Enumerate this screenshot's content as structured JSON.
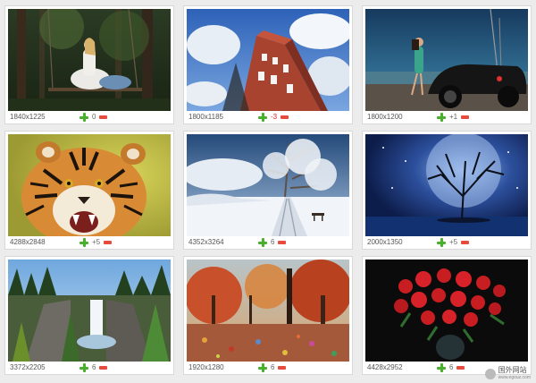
{
  "cards": [
    {
      "dims": "1840x1225",
      "score": "0",
      "scene": "forest-swing-photo"
    },
    {
      "dims": "1800x1185",
      "score": "-3",
      "scene": "tower-sky-photo"
    },
    {
      "dims": "1800x1200",
      "score": "+1",
      "scene": "woman-car-photo"
    },
    {
      "dims": "4288x2848",
      "score": "+5",
      "scene": "tiger-photo"
    },
    {
      "dims": "4352x3264",
      "score": "6",
      "scene": "snow-road-photo"
    },
    {
      "dims": "2000x1350",
      "score": "+5",
      "scene": "moon-tree-photo"
    },
    {
      "dims": "3372x2205",
      "score": "6",
      "scene": "waterfall-photo"
    },
    {
      "dims": "1920x1280",
      "score": "6",
      "scene": "autumn-park-photo"
    },
    {
      "dims": "4428x2952",
      "score": "6",
      "scene": "red-roses-photo"
    }
  ],
  "watermark": {
    "title": "国外网站",
    "url": "www.egouz.com"
  },
  "colors": {
    "plus": "#49b02b",
    "minus": "#e64b3c",
    "negative_score": "#dd2222"
  },
  "icons": [
    "plus-icon",
    "minus-icon"
  ]
}
